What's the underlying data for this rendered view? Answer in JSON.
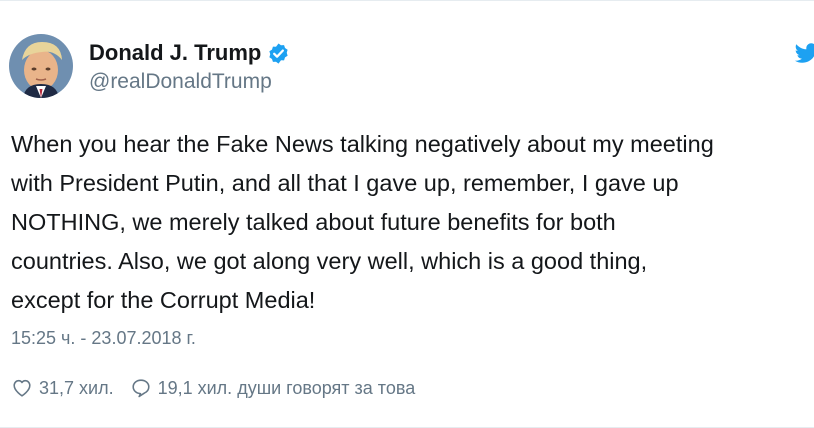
{
  "tweet": {
    "author": {
      "display_name": "Donald J. Trump",
      "handle": "@realDonaldTrump",
      "verified_icon": "verified-badge-icon",
      "avatar": "profile-photo"
    },
    "brand_icon": "twitter-bird-icon",
    "text": "When you hear the Fake News talking negatively about my meeting\nwith President Putin, and all that I gave up, remember, I gave up\nNOTHING, we merely talked about future benefits for both\ncountries. Also, we got along very well, which is a good thing,\nexcept for the Corrupt Media!",
    "timestamp": "15:25 ч. - 23.07.2018 г.",
    "likes": {
      "icon": "heart-icon",
      "count": "31,7 хил."
    },
    "talking": {
      "icon": "comment-icon",
      "text": "19,1 хил. души говорят за това"
    }
  },
  "colors": {
    "text": "#14171a",
    "secondary": "#657786",
    "twitter_blue": "#1da1f2"
  }
}
